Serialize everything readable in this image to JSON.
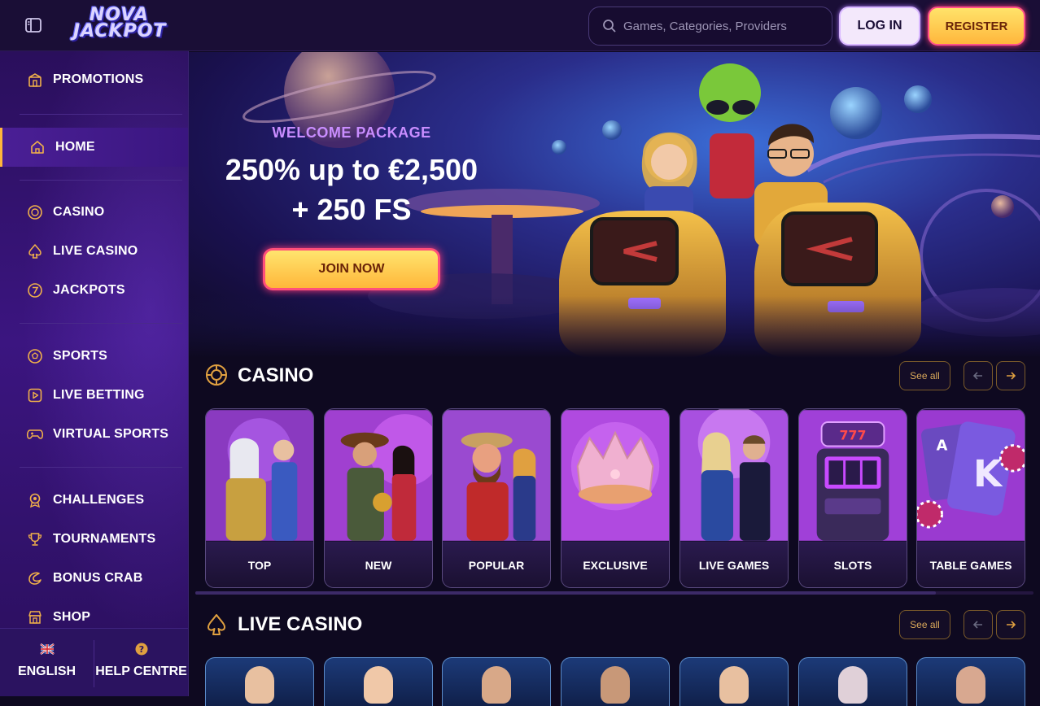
{
  "header": {
    "logo_line1": "NOVA",
    "logo_line2": "JACKPOT",
    "search_placeholder": "Games, Categories, Providers",
    "login_label": "LOG IN",
    "register_label": "REGISTER"
  },
  "sidebar": {
    "items": [
      {
        "label": "PROMOTIONS",
        "icon": "gift-shop-icon"
      },
      {
        "label": "HOME",
        "icon": "home-icon",
        "active": true
      },
      {
        "label": "CASINO",
        "icon": "chip-icon"
      },
      {
        "label": "LIVE CASINO",
        "icon": "spade-icon"
      },
      {
        "label": "JACKPOTS",
        "icon": "seven-icon"
      },
      {
        "label": "SPORTS",
        "icon": "football-icon"
      },
      {
        "label": "LIVE BETTING",
        "icon": "play-icon"
      },
      {
        "label": "VIRTUAL SPORTS",
        "icon": "gamepad-icon"
      },
      {
        "label": "CHALLENGES",
        "icon": "medal-icon"
      },
      {
        "label": "TOURNAMENTS",
        "icon": "trophy-icon"
      },
      {
        "label": "BONUS CRAB",
        "icon": "crab-icon"
      },
      {
        "label": "SHOP",
        "icon": "shop-icon"
      }
    ],
    "footer": {
      "language_label": "ENGLISH",
      "help_label": "HELP CENTRE"
    }
  },
  "hero": {
    "kicker": "WELCOME PACKAGE",
    "line1": "250% up to €2,500",
    "line2": "+ 250 FS",
    "cta_label": "JOIN NOW"
  },
  "casino_section": {
    "title": "CASINO",
    "see_all_label": "See all",
    "categories": [
      "TOP",
      "NEW",
      "POPULAR",
      "EXCLUSIVE",
      "LIVE GAMES",
      "SLOTS",
      "TABLE GAMES"
    ]
  },
  "live_casino_section": {
    "title": "LIVE CASINO",
    "see_all_label": "See all"
  },
  "colors": {
    "accent_gold": "#ffb63c",
    "accent_pink": "#ff4f8a",
    "sidebar_purple": "#3b1580",
    "background": "#0e0920"
  }
}
